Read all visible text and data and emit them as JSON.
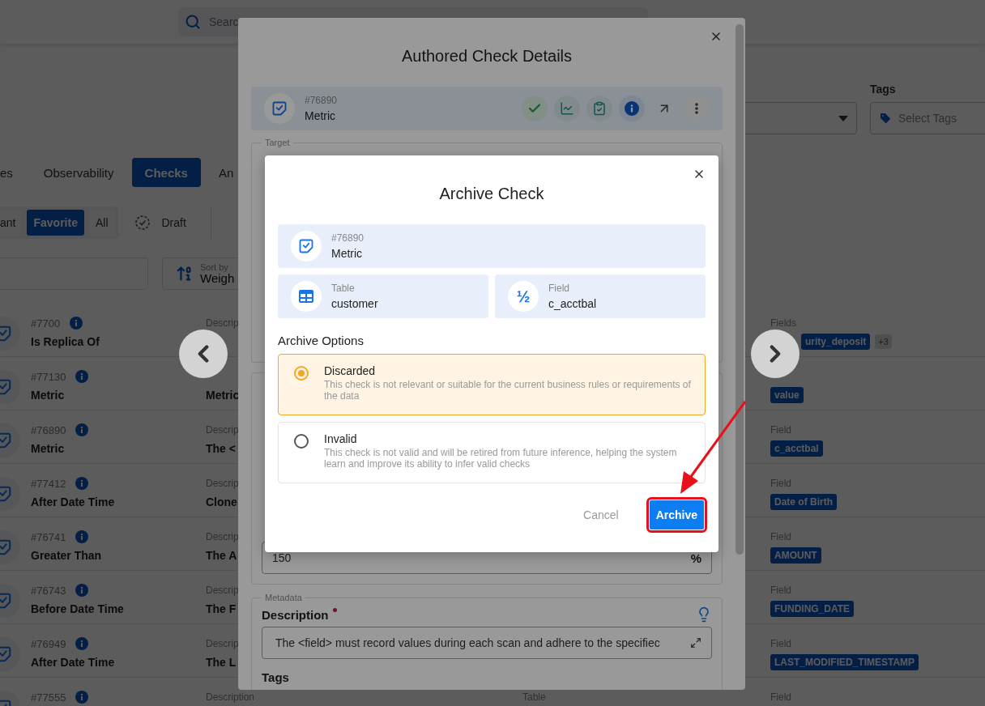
{
  "top_bar": {
    "search": {
      "placeholder": "Searc"
    }
  },
  "filters": {
    "tags_label": "Tags",
    "tags_select": {
      "placeholder": "Select Tags"
    }
  },
  "tabs": [
    {
      "label": "es",
      "selected": false
    },
    {
      "label": "Observability",
      "selected": false
    },
    {
      "label": "Checks",
      "selected": true
    },
    {
      "label": "An",
      "selected": false
    }
  ],
  "status_filters": [
    {
      "label": "ant",
      "selected": false
    },
    {
      "label": "Favorite",
      "selected": true
    },
    {
      "label": "All",
      "selected": false
    }
  ],
  "draft": {
    "label": "Draft"
  },
  "sort": {
    "label": "Sort by",
    "value": "Weigh"
  },
  "checks": [
    {
      "id": "#7700",
      "name": "Is Replica Of",
      "description_label": "Descrip",
      "covered": true,
      "field_label": "Fields",
      "fields": [
        "urity_deposit"
      ],
      "more": "+3"
    },
    {
      "id": "#77130",
      "name": "Metric",
      "description": "Metric",
      "fields": [
        "value"
      ]
    },
    {
      "id": "#76890",
      "name": "Metric",
      "description_label": "Descrip",
      "description": "The <",
      "field_label": "Field",
      "fields": [
        "c_acctbal"
      ]
    },
    {
      "id": "#77412",
      "name": "After Date Time",
      "description_label": "Descrip",
      "description": "Clone",
      "field_label": "Field",
      "fields": [
        "Date of Birth"
      ]
    },
    {
      "id": "#76741",
      "name": "Greater Than",
      "description_label": "Descrip",
      "description": "The A",
      "field_label": "Field",
      "fields": [
        "AMOUNT"
      ]
    },
    {
      "id": "#76743",
      "name": "Before Date Time",
      "description_label": "Descrip",
      "description": "The F",
      "field_label": "Field",
      "fields": [
        "FUNDING_DATE"
      ]
    },
    {
      "id": "#76949",
      "name": "After Date Time",
      "description_label": "Descrip",
      "description": "The L",
      "field_label": "Field",
      "fields": [
        "LAST_MODIFIED_TIMESTAMP"
      ]
    },
    {
      "id": "#77555",
      "description_label": "Description",
      "table_label": "Table",
      "field_label": "Field"
    }
  ],
  "details_dialog": {
    "title": "Authored Check Details",
    "check": {
      "id": "#76890",
      "name": "Metric"
    },
    "target_legend": "Target",
    "threshold": {
      "value": "150",
      "unit": "%"
    },
    "metadata_legend": "Metadata",
    "description_label": "Description",
    "description_value": "The <field> must record values during each scan and adhere to the specifiec",
    "tags_label": "Tags"
  },
  "archive_dialog": {
    "title": "Archive Check",
    "check": {
      "id": "#76890",
      "name": "Metric"
    },
    "table": {
      "label": "Table",
      "value": "customer"
    },
    "field": {
      "icon": "½",
      "label": "Field",
      "value": "c_acctbal"
    },
    "options_label": "Archive Options",
    "options": [
      {
        "title": "Discarded",
        "description": "This check is not relevant or suitable for the current business rules or requirements of the data",
        "selected": true
      },
      {
        "title": "Invalid",
        "description": "This check is not valid and will be retired from future inference, helping the system learn and improve its ability to infer valid checks",
        "selected": false
      }
    ],
    "buttons": [
      {
        "label": "Cancel",
        "kind": "secondary"
      },
      {
        "label": "Archive",
        "kind": "primary"
      }
    ]
  }
}
